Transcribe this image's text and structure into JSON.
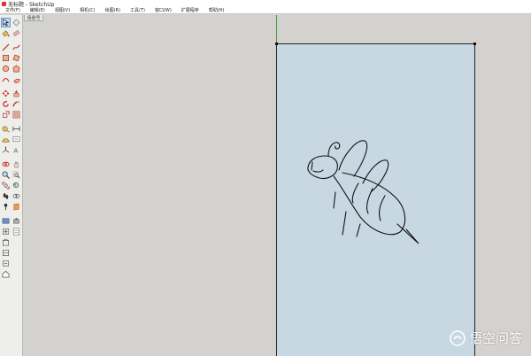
{
  "window": {
    "title": "无标题 - SketchUp"
  },
  "menubar": {
    "items": [
      "文件(F)",
      "编辑(E)",
      "视图(V)",
      "相机(C)",
      "绘图(R)",
      "工具(T)",
      "窗口(W)",
      "扩展程序",
      "帮助(H)"
    ]
  },
  "toolbar": {
    "tools": [
      "select",
      "eraser",
      "paint-bucket",
      "eraser-alt",
      "line",
      "freehand",
      "rectangle",
      "rotated-rectangle",
      "circle",
      "polygon",
      "arc",
      "pie",
      "move",
      "push-pull",
      "rotate",
      "follow-me",
      "scale",
      "offset",
      "tape-measure",
      "dimension",
      "protractor",
      "text",
      "axes",
      "3d-text",
      "orbit",
      "pan",
      "zoom",
      "zoom-window",
      "zoom-extents",
      "previous",
      "walk",
      "look-around",
      "position-camera",
      "section-plane",
      "warehouse",
      "share",
      "extension",
      "layout",
      "component",
      "materials",
      "styles",
      "house"
    ]
  },
  "viewport": {
    "scene_tab": "场景号",
    "colors": {
      "page": "#c7d8e2",
      "background": "#d4d2ce",
      "green_axis": "#3f9a3f"
    }
  },
  "watermark": {
    "text": "悟空问答"
  }
}
